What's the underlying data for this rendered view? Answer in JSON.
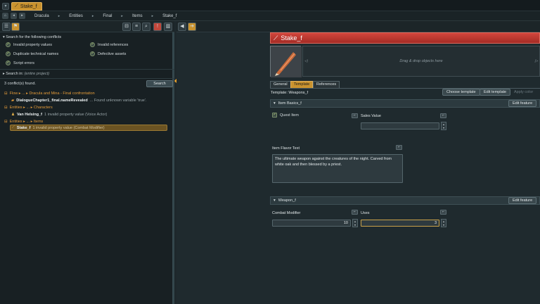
{
  "tab": {
    "label": "Stake_f",
    "menu_glyph": "▾"
  },
  "breadcrumb": [
    "Dracula",
    "Entities",
    "Final",
    "Items",
    "Stake_f"
  ],
  "search_panel": {
    "header": "Search for the following conflicts",
    "options": [
      {
        "label": "Invalid property values",
        "checked": true
      },
      {
        "label": "Invalid references",
        "checked": true
      },
      {
        "label": "Duplicate technical names",
        "checked": true
      },
      {
        "label": "Defective assets",
        "checked": true
      },
      {
        "label": "Script errors",
        "checked": true
      }
    ],
    "search_in_label": "Search in:",
    "search_in_value": "(entire project)",
    "result_text": "3 conflict(s) found.",
    "search_button": "Search"
  },
  "results": [
    {
      "path": "Flow ▸ ... ▸ Dracula and Mina - Final confrontation",
      "kind": "group"
    },
    {
      "name": "DialogueChapter1_final.nameRevealed",
      "message": "... Found unknown variable 'true'.",
      "kind": "item"
    },
    {
      "path": "Entities ▸ ... ▸ Characters",
      "kind": "group"
    },
    {
      "name": "Van Helsing_f",
      "message": "1 invalid property value (Voice Actor)",
      "kind": "item"
    },
    {
      "path": "Entities ▸ ... ▸ Items",
      "kind": "group"
    },
    {
      "name": "Stake_f",
      "message": "1 invalid property value (Combat Modifier)",
      "kind": "item",
      "selected": true
    }
  ],
  "object": {
    "title": "Stake_f",
    "dropzone_text": "Drag & drop objects here",
    "tabs": [
      "General",
      "Template",
      "References"
    ],
    "active_tab": "Template",
    "template_label": "Template: Weapons_f",
    "buttons": {
      "choose": "Choose template",
      "edit": "Edit template",
      "apply": "Apply color"
    },
    "features": [
      {
        "title": "Item Basics_f",
        "edit": "Edit feature",
        "quest_item_label": "Quest Item",
        "quest_item_checked": true,
        "sales_value_label": "Sales Value",
        "sales_value": "",
        "flavor_label": "Item Flavor Text",
        "flavor_text": "The ultimate weapon against the creatures of the night. Carved from white oak and then blessed by a priest."
      },
      {
        "title": "Weapon_f",
        "edit": "Edit feature",
        "combat_modifier_label": "Combat Modifier",
        "combat_modifier": "10",
        "uses_label": "Uses",
        "uses": "3"
      }
    ]
  },
  "colors": {
    "accent_orange": "#c9922e",
    "title_red": "#c23a32",
    "arrow_orange": "#f2a52c"
  }
}
